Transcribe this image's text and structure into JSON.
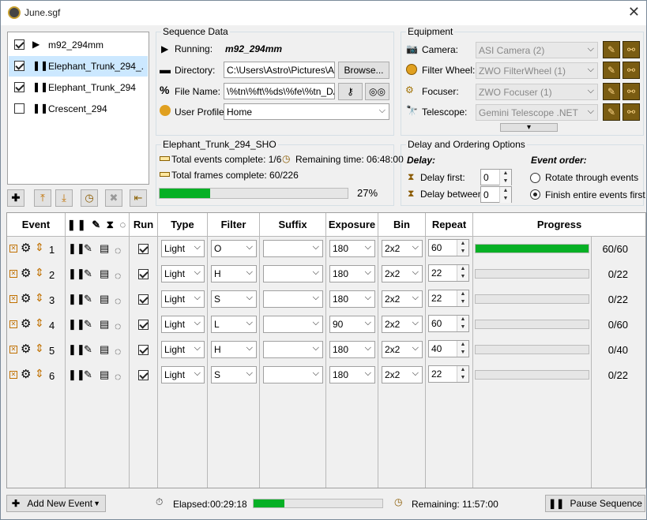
{
  "window": {
    "title": "June.sgf",
    "close": "✕"
  },
  "sequences": [
    {
      "name": "m92_294mm",
      "checked": true,
      "state": "▶",
      "selected": false
    },
    {
      "name": "Elephant_Trunk_294_...",
      "checked": true,
      "state": "❚❚",
      "selected": true
    },
    {
      "name": "Elephant_Trunk_294",
      "checked": true,
      "state": "❚❚",
      "selected": false
    },
    {
      "name": "Crescent_294",
      "checked": false,
      "state": "❚❚",
      "selected": false
    }
  ],
  "sequence_data": {
    "group": "Sequence Data",
    "running_label": "Running:",
    "running_value": "m92_294mm",
    "directory_label": "Directory:",
    "directory_value": "C:\\Users\\Astro\\Pictures\\Astr",
    "browse": "Browse...",
    "filename_label": "File Name:",
    "filename_value": "\\%tn\\%ft\\%ds\\%fe\\%tn_DAT",
    "profile_label": "User Profile:",
    "profile_value": "Home"
  },
  "equipment": {
    "group": "Equipment",
    "camera_label": "Camera:",
    "camera_value": "ASI Camera (2)",
    "filter_label": "Filter Wheel:",
    "filter_value": "ZWO FilterWheel (1)",
    "focuser_label": "Focuser:",
    "focuser_value": "ZWO Focuser (1)",
    "telescope_label": "Telescope:",
    "telescope_value": "Gemini Telescope .NET",
    "more": "▾"
  },
  "progress_group": {
    "group": "Elephant_Trunk_294_SHO",
    "events_label": "Total events complete: 1/6",
    "remaining_label": "Remaining time: 06:48:00",
    "frames_label": "Total frames complete: 60/226",
    "percent": "27%",
    "fraction": 0.27
  },
  "delay": {
    "group": "Delay and Ordering Options",
    "delay_title": "Delay:",
    "first_label": "Delay first:",
    "first_value": "0",
    "between_label": "Delay between:",
    "between_value": "0",
    "order_title": "Event order:",
    "rotate": "Rotate through events",
    "finish": "Finish entire events first"
  },
  "table": {
    "headers": [
      "Event",
      "",
      "Run",
      "Type",
      "Filter",
      "Suffix",
      "Exposure",
      "Bin",
      "Repeat",
      "Progress"
    ],
    "rows": [
      {
        "num": "1",
        "type": "Light",
        "filter": "O",
        "suffix": "",
        "exposure": "180",
        "bin": "2x2",
        "repeat": "60",
        "progress": "60/60",
        "fraction": 1.0
      },
      {
        "num": "2",
        "type": "Light",
        "filter": "H",
        "suffix": "",
        "exposure": "180",
        "bin": "2x2",
        "repeat": "22",
        "progress": "0/22",
        "fraction": 0
      },
      {
        "num": "3",
        "type": "Light",
        "filter": "S",
        "suffix": "",
        "exposure": "180",
        "bin": "2x2",
        "repeat": "22",
        "progress": "0/22",
        "fraction": 0
      },
      {
        "num": "4",
        "type": "Light",
        "filter": "L",
        "suffix": "",
        "exposure": "90",
        "bin": "2x2",
        "repeat": "60",
        "progress": "0/60",
        "fraction": 0
      },
      {
        "num": "5",
        "type": "Light",
        "filter": "H",
        "suffix": "",
        "exposure": "180",
        "bin": "2x2",
        "repeat": "40",
        "progress": "0/40",
        "fraction": 0
      },
      {
        "num": "6",
        "type": "Light",
        "filter": "S",
        "suffix": "",
        "exposure": "180",
        "bin": "2x2",
        "repeat": "22",
        "progress": "0/22",
        "fraction": 0
      }
    ]
  },
  "footer": {
    "add_event": "Add New Event",
    "elapsed_label": "Elapsed:",
    "elapsed_value": "00:29:18",
    "elapsed_fraction": 0.24,
    "remaining_label": "Remaining:",
    "remaining_value": "11:57:00",
    "pause": "Pause Sequence"
  }
}
